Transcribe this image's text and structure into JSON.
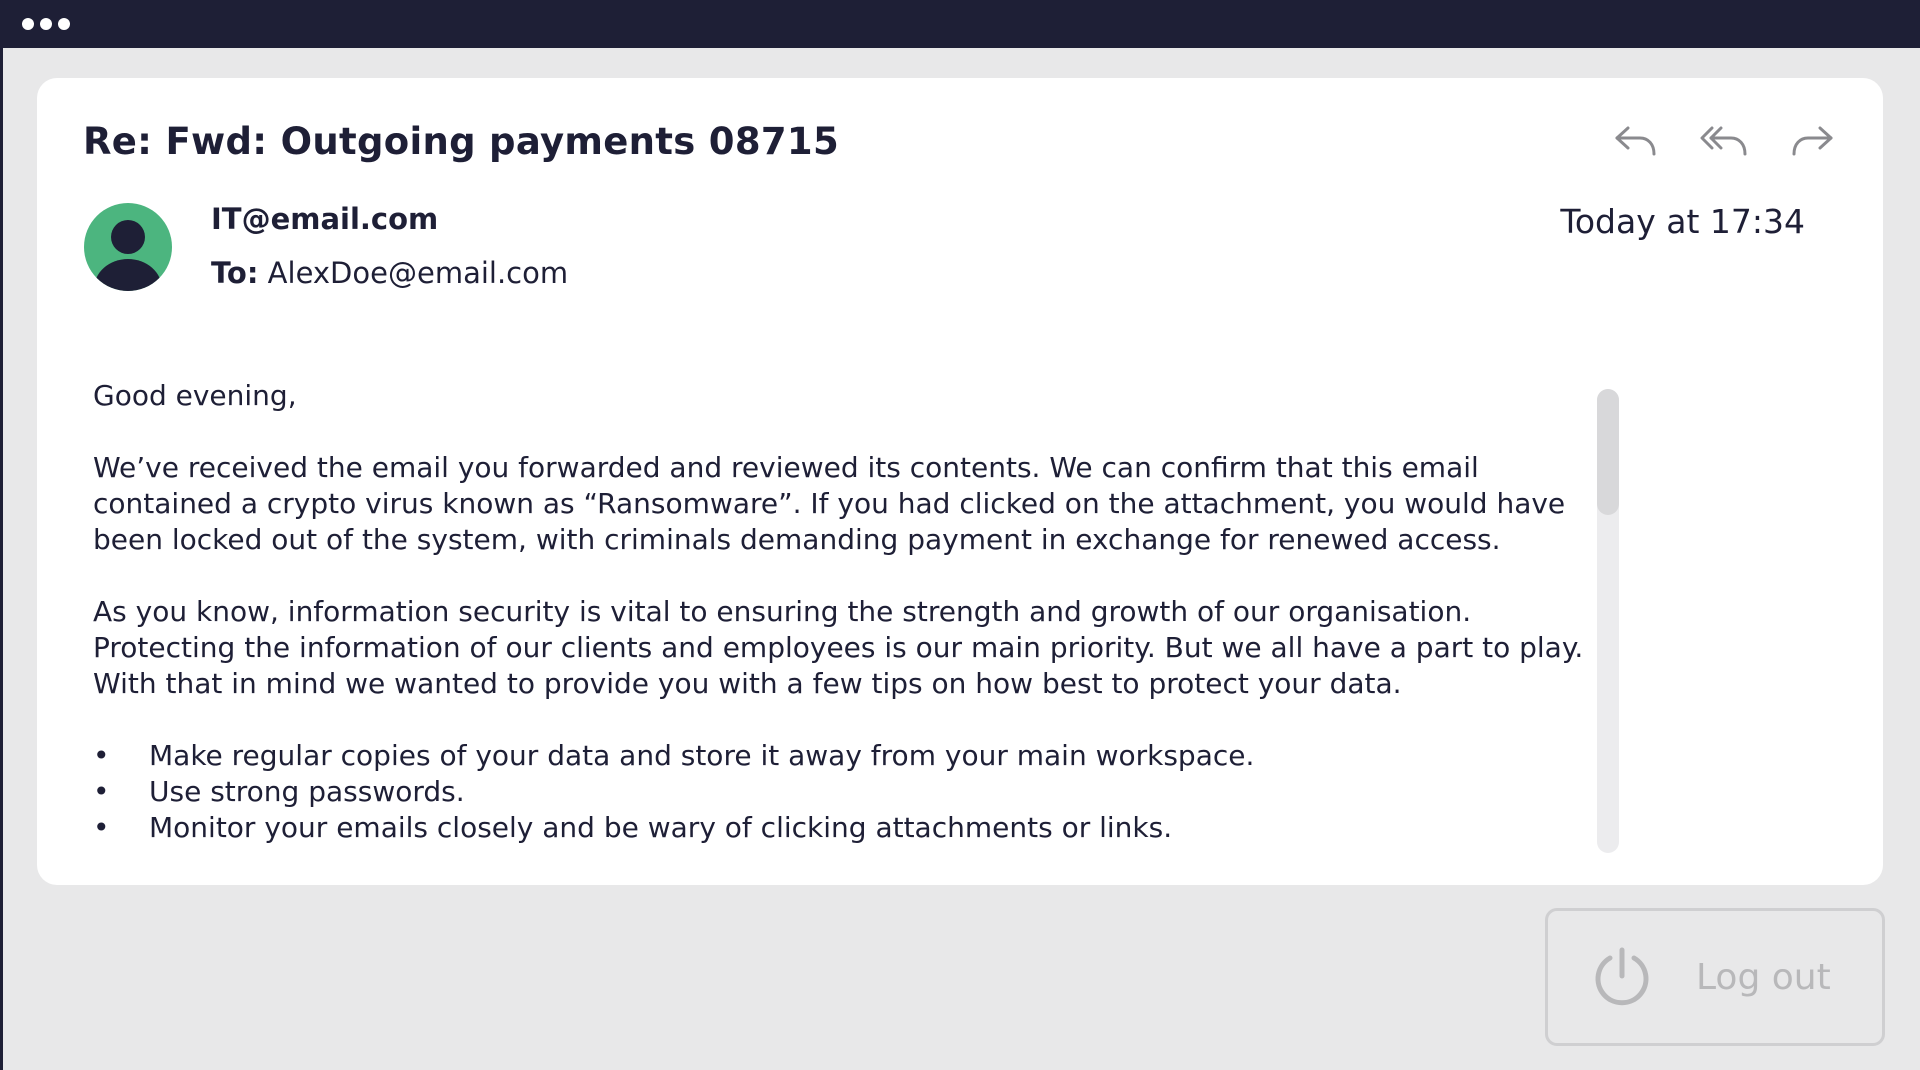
{
  "window": {
    "icon": "dots-menu-icon"
  },
  "email": {
    "subject": "Re: Fwd: Outgoing payments 08715",
    "from": "IT@email.com",
    "to_label": "To:",
    "to": "AlexDoe@email.com",
    "timestamp": "Today at 17:34",
    "actions": {
      "reply_icon": "reply-icon",
      "reply_all_icon": "reply-all-icon",
      "forward_icon": "forward-icon"
    },
    "body": {
      "greeting": "Good evening,",
      "paragraph1": "We’ve received the email you forwarded and reviewed its contents. We can confirm that this email contained a crypto virus known as “Ransomware”. If you had clicked on the attachment, you would have been locked out of the system, with criminals demanding payment in exchange for renewed access.",
      "paragraph2": "As you know, information security is vital to ensuring the strength and growth of our organisation. Protecting the information of our clients and employees is our main priority. But we all have a part to play. With that in mind we wanted to provide you with a few tips on how best to protect your data.",
      "tips": [
        "Make regular copies of your data and store it away from your main workspace.",
        "Use strong passwords.",
        "Monitor your emails closely and be wary of clicking attachments or links."
      ],
      "bullet": "•"
    }
  },
  "logout": {
    "label": "Log out",
    "icon": "power-icon"
  },
  "colors": {
    "dark": "#1e1f36",
    "avatar": "#4cb57f",
    "background": "#e8e8e9"
  }
}
